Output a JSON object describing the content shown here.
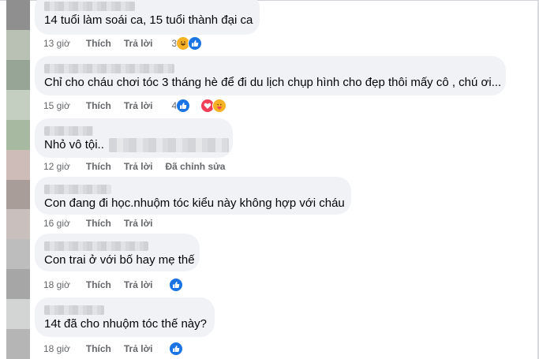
{
  "comments": [
    {
      "text": "14 tuổi làm soái ca, 15 tuổi thành đại ca",
      "time": "13 giờ",
      "like": "Thích",
      "reply": "Trả lời",
      "reaction_count": "3",
      "reactions": [
        "haha-icon",
        "like-icon"
      ]
    },
    {
      "text": "Chỉ cho cháu chơi tóc 3 tháng hè để đi du lịch chụp hình cho đẹp thôi mấy cô , chú ơi...",
      "time": "15 giờ",
      "like": "Thích",
      "reply": "Trả lời",
      "reaction_count": "4",
      "reactions": [
        "like-icon",
        "love-icon",
        "care-icon"
      ]
    },
    {
      "text": "Nhỏ vô tội..",
      "time": "12 giờ",
      "like": "Thích",
      "reply": "Trả lời",
      "edited": "Đã chỉnh sửa"
    },
    {
      "text": "Con đang đi học.nhuộm tóc kiểu này không hợp với cháu",
      "time": "16 giờ",
      "like": "Thích",
      "reply": "Trả lời"
    },
    {
      "text": "Con trai ở với bố hay mẹ thế",
      "time": "18 giờ",
      "like": "Thích",
      "reply": "Trả lời",
      "reactions": [
        "like-icon"
      ]
    },
    {
      "text": "14t đã cho nhuộm tóc thế này?",
      "time": "18 giờ",
      "like": "Thích",
      "reply": "Trả lời",
      "reactions": [
        "like-icon"
      ]
    }
  ],
  "colors": {
    "bubble": "#f0f2f5",
    "meta": "#65676b",
    "like_blue": "#1b74e4",
    "love_red": "#f33e58",
    "haha_yellow": "#f7b125"
  }
}
